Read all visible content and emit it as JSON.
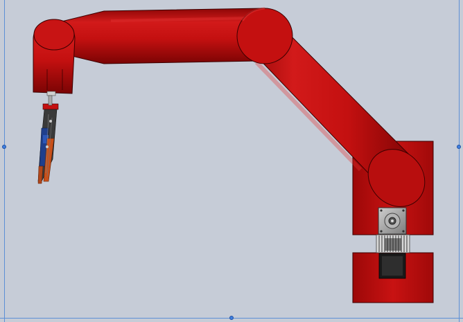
{
  "viewport": {
    "background": "#c6ccd7",
    "selection_frame_color": "#5c8fd6",
    "handle_color": "#3f7fe0"
  },
  "model": {
    "components": [
      "base-block",
      "lower-arm-link",
      "upper-arm-link",
      "wrist-link",
      "stepper-motor",
      "gear-coupling",
      "gripper-end-effector"
    ],
    "colors": {
      "body": "#c41010",
      "body_shadow": "#7a0404",
      "body_highlight": "#e23030",
      "motor": "#9a9a9a",
      "motor_dark": "#222222",
      "gripper_blue": "#1f3f8c",
      "gripper_orange": "#c8501a"
    }
  },
  "selection": {
    "handles": [
      "left-mid",
      "right-mid",
      "bottom-mid"
    ]
  }
}
